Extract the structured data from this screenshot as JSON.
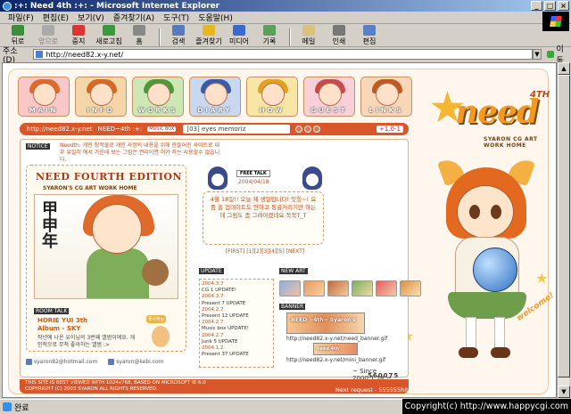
{
  "window": {
    "title": ":+: Need 4th :+: - Microsoft Internet Explorer"
  },
  "menu": [
    "파일(F)",
    "편집(E)",
    "보기(V)",
    "즐겨찾기(A)",
    "도구(T)",
    "도움말(H)"
  ],
  "toolbar": [
    {
      "label": "뒤로",
      "icon": "back-arrow-icon",
      "disabled": false
    },
    {
      "label": "앞으로",
      "icon": "forward-arrow-icon",
      "disabled": true
    },
    {
      "label": "중지",
      "icon": "stop-icon",
      "disabled": false
    },
    {
      "label": "새로고침",
      "icon": "refresh-icon",
      "disabled": false
    },
    {
      "label": "홈",
      "icon": "home-icon",
      "disabled": false
    },
    {
      "label": "검색",
      "icon": "search-icon",
      "disabled": false
    },
    {
      "label": "즐겨찾기",
      "icon": "favorites-icon",
      "disabled": false
    },
    {
      "label": "미디어",
      "icon": "media-icon",
      "disabled": false
    },
    {
      "label": "기록",
      "icon": "history-icon",
      "disabled": false
    },
    {
      "label": "메일",
      "icon": "mail-icon",
      "disabled": false
    },
    {
      "label": "인쇄",
      "icon": "print-icon",
      "disabled": false
    },
    {
      "label": "편집",
      "icon": "edit-icon",
      "disabled": false
    }
  ],
  "address": {
    "label": "주소(D)",
    "url": "http://need82.x-y.net/",
    "go": "이동"
  },
  "site": {
    "nav": [
      "MAIN",
      "INFO",
      "WORKS",
      "DIARY",
      "HOW",
      "GUEST",
      "LINKS"
    ],
    "logo": {
      "sup": "4TH",
      "word": "need",
      "sub": "SYARON CG ART WORK HOME"
    },
    "strip": {
      "url": "http://need82.x-y.net",
      "brand": "NEED~4th :+:",
      "musicbox": "MUSIC BOX",
      "track": "[03] eyes memoriz",
      "num": "+1.0-1"
    },
    "notice": {
      "label": "NOTICE",
      "text": "Needth: 개인 창작물로 개인 사정의 내용을 위해 만들어진 사이트로 대부 유일히 에서 가운데 보는 그림은 권리이면 허가 하는 사용할수 없습니다."
    },
    "album": {
      "title": "NEED FOURTH EDITION",
      "subtitle": "SYARON'S CG ART WORK HOME",
      "kanji": "甲申年",
      "talk_label": "ROOM TALK",
      "talk_title1": "HORIE YUI 3th",
      "talk_title2": "Album - SKY",
      "talk_body": "작년에 나온 유이님의 3번째 앨범이에요. 개인적으로 무척 좋아하는 앨범 :>",
      "bubble": "좋아하는"
    },
    "contacts": [
      "syaron82@hotmail.com",
      "syaron@kebi.com"
    ],
    "freetalk": {
      "label": "FREE TALK",
      "date": "2004/04/18",
      "body": "4월 18일!! 오늘 제 생일입니다! 잇힝~! 요즘 홈 업데이트도 안하고 뒹굴거리기만 하는데 그림도 좀 그려야겠네요 꼭꼭T_T",
      "pages": "[FIRST] [1][2][3][4][5] [NEXT]"
    },
    "updates": {
      "label": "UPDATE",
      "items": [
        {
          "date": "2004.3.7",
          "text": "CG 1 UPDATE!"
        },
        {
          "date": "2004.3.7",
          "text": "Present 7 UPDATE"
        },
        {
          "date": "2004.2.7",
          "text": "Present 12 UPDATE"
        },
        {
          "date": "2004.2.7",
          "text": "Music box UPDATE!"
        },
        {
          "date": "2004.2.7",
          "text": "Junk 5 UPDATE"
        },
        {
          "date": "2004.1.2",
          "text": "Present 37 UPDATE"
        }
      ]
    },
    "newart": {
      "label": "NEW ART"
    },
    "banner": {
      "label": "BANNER",
      "b1": "NEED ~4th~ Syaron's",
      "url1": "http://need82.x-y.net/need_banner.gif",
      "b2": "need 4th",
      "url2": "http://need82.x-y.net/mini_banner.gif"
    },
    "since": "~ Since 2000.1.18 ~",
    "count": "560075",
    "footer1": "THIS SITE IS BEST VIEWED WITH 1024x768, BASED ON MICROSOFT IE 6.0",
    "footer2": "COPYRIGHT (C) 2003 SYARON ALL RIGHTS RESERVED.",
    "nextreq": "Next request - 555555hit",
    "welcome": "welcome!"
  },
  "status": {
    "text": "완료",
    "copyright": "Copyright(c) http://www.happycgi.com"
  },
  "colors": {
    "accent": "#d8562a",
    "logo": "#f39a1e",
    "titlebar": "#0a246a"
  }
}
